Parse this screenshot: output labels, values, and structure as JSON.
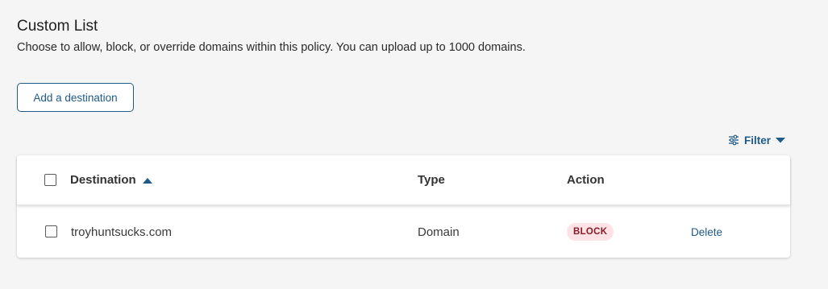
{
  "header": {
    "title": "Custom List",
    "description": "Choose to allow, block, or override domains within this policy. You can upload up to 1000 domains."
  },
  "toolbar": {
    "add_label": "Add a destination",
    "filter_label": "Filter",
    "filter_icon": "sliders-icon",
    "filter_caret_icon": "caret-down-icon"
  },
  "table": {
    "columns": {
      "destination": "Destination",
      "type": "Type",
      "action": "Action"
    },
    "sort": {
      "column": "Destination",
      "direction": "ascending"
    },
    "rows": [
      {
        "destination": "troyhuntsucks.com",
        "type": "Domain",
        "action": "BLOCK",
        "delete_label": "Delete"
      }
    ]
  },
  "colors": {
    "accent": "#1f5a8a",
    "block_badge_bg": "#fde3e6",
    "block_badge_text": "#8a1a2a",
    "page_bg": "#f5f5f5"
  }
}
